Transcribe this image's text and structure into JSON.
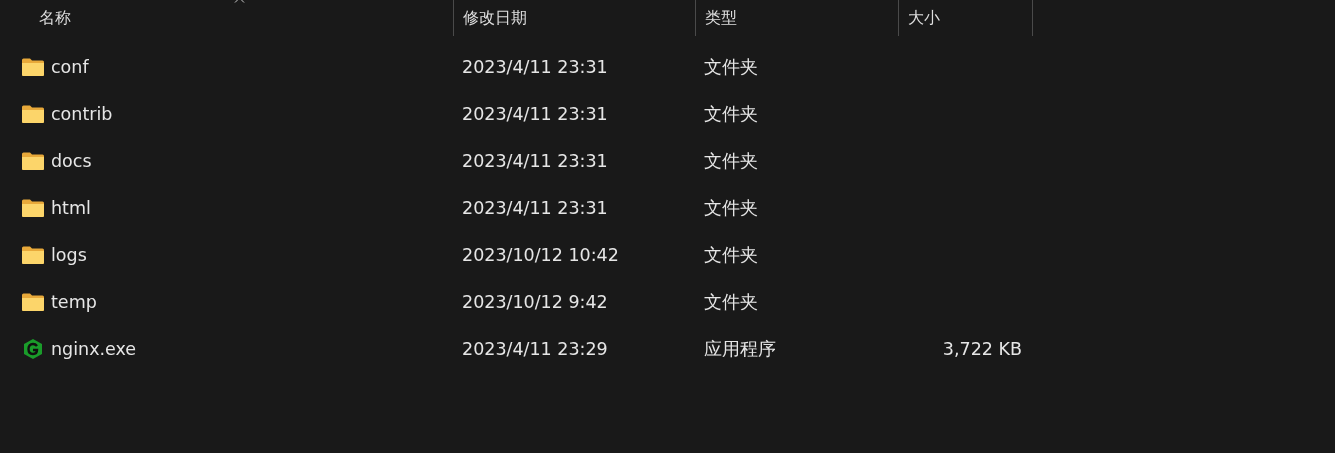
{
  "table": {
    "columns": [
      {
        "label": "名称",
        "sorted": true
      },
      {
        "label": "修改日期",
        "sorted": false
      },
      {
        "label": "类型",
        "sorted": false
      },
      {
        "label": "大小",
        "sorted": false
      }
    ],
    "rows": [
      {
        "kind": "folder",
        "name": "conf",
        "modified": "2023/4/11 23:31",
        "type": "文件夹"
      },
      {
        "kind": "folder",
        "name": "contrib",
        "modified": "2023/4/11 23:31",
        "type": "文件夹"
      },
      {
        "kind": "folder",
        "name": "docs",
        "modified": "2023/4/11 23:31",
        "type": "文件夹"
      },
      {
        "kind": "folder",
        "name": "html",
        "modified": "2023/4/11 23:31",
        "type": "文件夹"
      },
      {
        "kind": "folder",
        "name": "logs",
        "modified": "2023/10/12 10:42",
        "type": "文件夹"
      },
      {
        "kind": "folder",
        "name": "temp",
        "modified": "2023/10/12 9:42",
        "type": "文件夹"
      },
      {
        "kind": "app",
        "name": "nginx.exe",
        "modified": "2023/4/11 23:29",
        "type": "应用程序",
        "size": "3,722 KB"
      }
    ]
  }
}
